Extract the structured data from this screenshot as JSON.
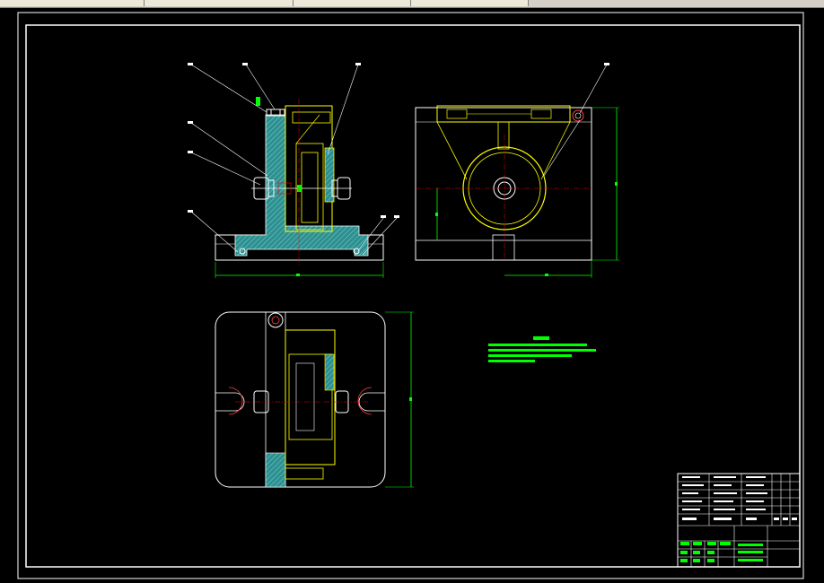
{
  "tabs": [
    {
      "label": ""
    },
    {
      "label": ""
    },
    {
      "label": ""
    },
    {
      "label": ""
    },
    {
      "label": ""
    }
  ],
  "colors": {
    "background": "#000000",
    "border": "#ffffff",
    "section_hatch": "#3aa7a7",
    "part_outline": "#ffff00",
    "dimension": "#00ff00",
    "centerline": "#ff0000",
    "notes_text": "#00ff00"
  },
  "drawing": {
    "views": [
      "front-section-view",
      "side-view",
      "top-view"
    ],
    "leader_labels": [
      "1",
      "2",
      "3",
      "4",
      "5",
      "6",
      "7",
      "8",
      "9"
    ],
    "dimension_labels": [
      "",
      "",
      "",
      ""
    ],
    "notes_title": "",
    "notes_lines": [
      "",
      "",
      "",
      ""
    ]
  },
  "title_block": {
    "rows": 10,
    "columns": 9
  }
}
